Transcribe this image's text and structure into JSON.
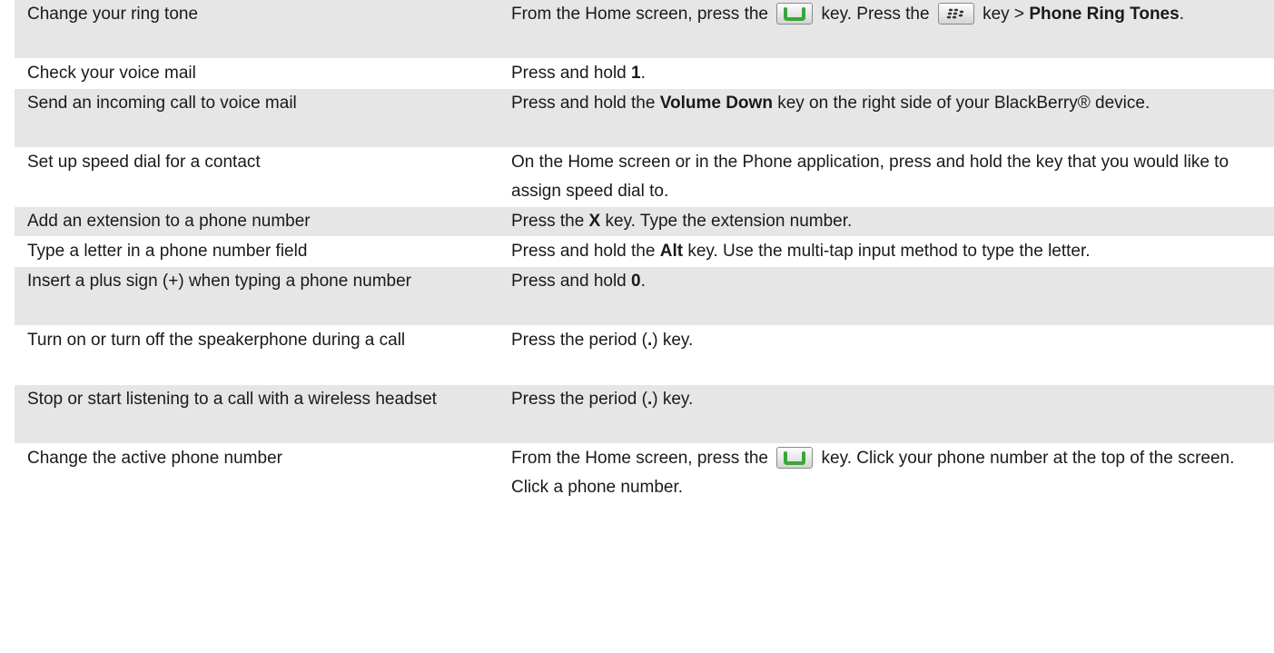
{
  "rows": [
    {
      "task": "Change your ring tone",
      "how": [
        {
          "t": "From the Home screen, press the "
        },
        {
          "icon": "send-key-icon"
        },
        {
          "t": " key. Press the "
        },
        {
          "icon": "menu-key-icon"
        },
        {
          "t": " key > "
        },
        {
          "b": "Phone Ring Tones"
        },
        {
          "t": "."
        }
      ]
    },
    {
      "task": "Check your voice mail",
      "how": [
        {
          "t": "Press and hold "
        },
        {
          "b": "1"
        },
        {
          "t": "."
        }
      ]
    },
    {
      "task": "Send an incoming call to voice mail",
      "how": [
        {
          "t": "Press and hold the "
        },
        {
          "b": "Volume Down"
        },
        {
          "t": " key on the right side of your BlackBerry® device."
        }
      ]
    },
    {
      "task": "Set up speed dial for a contact",
      "how": [
        {
          "t": "On the Home screen or in the Phone application, press and hold the key that you would like to assign speed dial to."
        }
      ]
    },
    {
      "task": "Add an extension to a phone number",
      "how": [
        {
          "t": "Press the "
        },
        {
          "b": "X"
        },
        {
          "t": " key. Type the extension number."
        }
      ]
    },
    {
      "task": "Type a letter in a phone number field",
      "how": [
        {
          "t": "Press and hold the "
        },
        {
          "b": "Alt"
        },
        {
          "t": " key. Use the multi-tap input method to type the letter."
        }
      ]
    },
    {
      "task": "Insert a plus sign (+) when typing a phone number",
      "how": [
        {
          "t": "Press and hold "
        },
        {
          "b": "0"
        },
        {
          "t": "."
        }
      ]
    },
    {
      "task": "Turn on or turn off the speakerphone during a call",
      "how": [
        {
          "t": "Press the period ("
        },
        {
          "b": "."
        },
        {
          "t": ") key."
        }
      ]
    },
    {
      "task": "Stop or start listening to a call with a wireless headset",
      "how": [
        {
          "t": "Press the period ("
        },
        {
          "b": "."
        },
        {
          "t": ") key."
        }
      ]
    },
    {
      "task": "Change the active phone number",
      "how": [
        {
          "t": "From the Home screen, press the "
        },
        {
          "icon": "send-key-icon"
        },
        {
          "t": " key. Click your phone number at the top of the screen. Click a phone number."
        }
      ]
    }
  ],
  "colors": {
    "shade": "#e6e6e6",
    "send_key_green": "#3aa53a"
  }
}
